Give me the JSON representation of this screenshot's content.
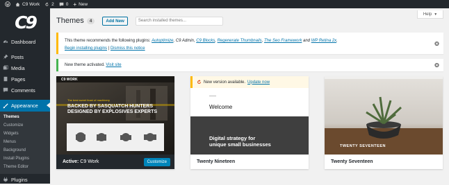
{
  "adminbar": {
    "site": "C9 Work",
    "updates": "2",
    "comments": "0",
    "new": "New"
  },
  "sidebar": {
    "logo": "C9",
    "items": [
      {
        "label": "Dashboard"
      },
      {
        "label": "Posts"
      },
      {
        "label": "Media"
      },
      {
        "label": "Pages"
      },
      {
        "label": "Comments"
      },
      {
        "label": "Appearance"
      }
    ],
    "submenu": [
      "Themes",
      "Customize",
      "Widgets",
      "Menus",
      "Background",
      "Install Plugins",
      "Theme Editor"
    ],
    "next": "Plugins"
  },
  "header": {
    "title": "Themes",
    "count": "4",
    "add_new": "Add New",
    "search_placeholder": "Search installed themes...",
    "help": "Help"
  },
  "notice_plugins": {
    "text": "This theme recommends the following plugins:",
    "plugins": [
      "Autoptimize",
      ", C9 Admin, ",
      "C9 Blocks",
      ", ",
      "Regenerate Thumbnails",
      ", ",
      "The Seo Framework",
      " and ",
      "WP Retina 2x",
      "."
    ],
    "begin": "Begin installing plugins",
    "sep": " | ",
    "dismiss": "Dismiss this notice"
  },
  "notice_activated": {
    "text": "New theme activated. ",
    "link": "Visit site"
  },
  "themes": [
    {
      "name": "C9 Work",
      "active_prefix": "Active:",
      "customize": "Customize",
      "shot": {
        "brand": "C9 WORK",
        "tag": "The best sweet feast of machinery",
        "headline1": "BACKED BY SASQUATCH HUNTERS",
        "headline2": "DESIGNED BY EXPLOSIVES EXPERTS"
      }
    },
    {
      "name": "Twenty Nineteen",
      "update_text": "New version available.",
      "update_link": "Update now",
      "shot": {
        "welcome": "Welcome",
        "tagline1": "Digital strategy for",
        "tagline2": "unique small businesses"
      }
    },
    {
      "name": "Twenty Seventeen",
      "shot": {
        "label": "TWENTY SEVENTEEN"
      }
    }
  ],
  "colors": {
    "accent": "#0073aa",
    "sidebar": "#23282d",
    "warning": "#ffb900",
    "success": "#46b450"
  }
}
